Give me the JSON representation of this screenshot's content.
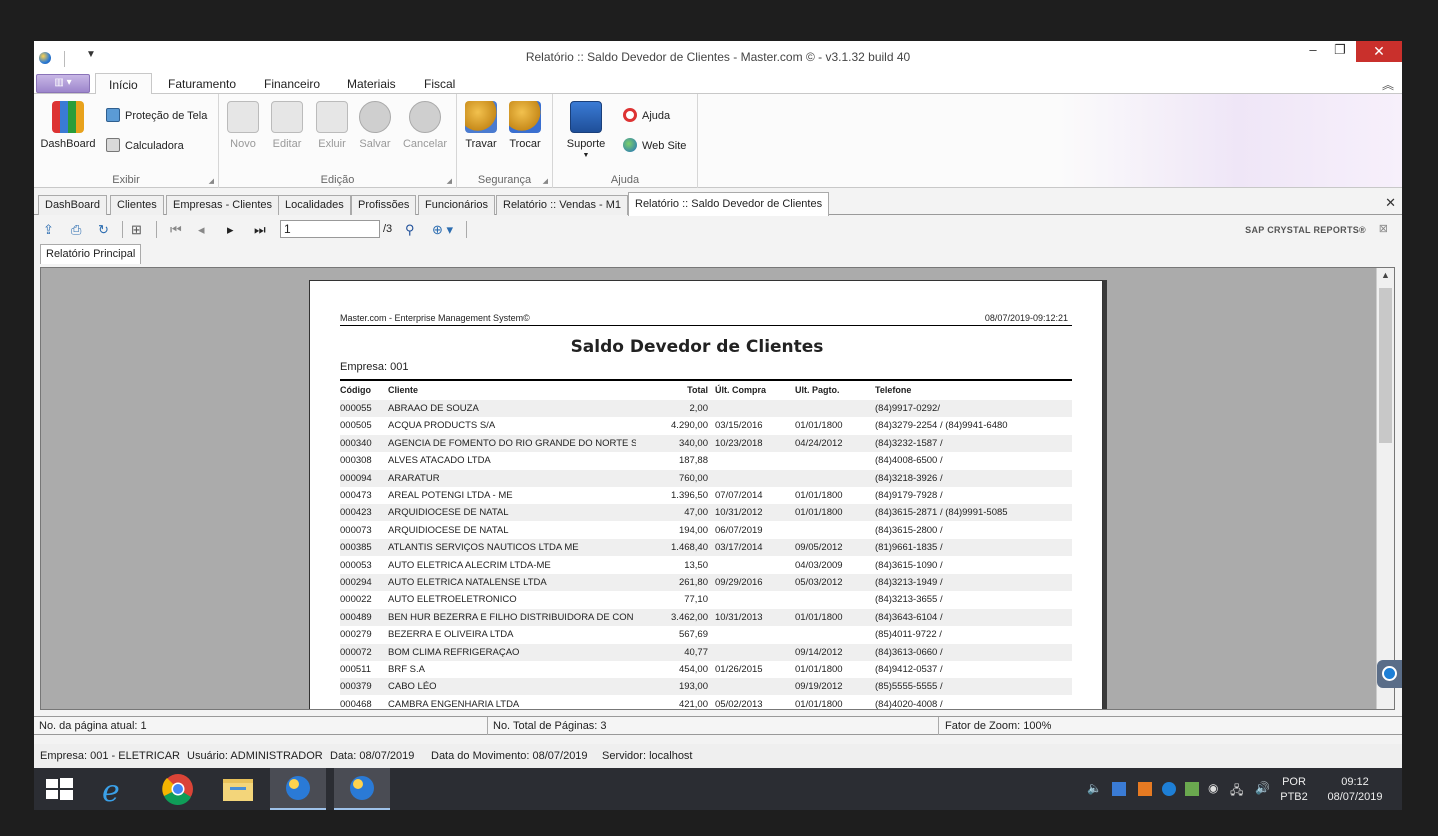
{
  "window": {
    "title": "Relatório :: Saldo Devedor de Clientes - Master.com © - v3.1.32 build 40",
    "controls": {
      "minimize": "–",
      "restore": "❐",
      "close": "✕"
    }
  },
  "ribbon": {
    "tabs": [
      "Início",
      "Faturamento",
      "Financeiro",
      "Materiais",
      "Fiscal"
    ],
    "active_tab": "Início",
    "groups": {
      "exibir": {
        "label": "Exibir",
        "dashboard": "DashBoard",
        "protecao": "Proteção de Tela",
        "calculadora": "Calculadora"
      },
      "edicao": {
        "label": "Edição",
        "novo": "Novo",
        "editar": "Editar",
        "excluir": "Exluir",
        "salvar": "Salvar",
        "cancelar": "Cancelar"
      },
      "seguranca": {
        "label": "Segurança",
        "travar": "Travar",
        "trocar": "Trocar"
      },
      "ajuda": {
        "label": "Ajuda",
        "suporte": "Suporte",
        "ajuda": "Ajuda",
        "website": "Web Site"
      }
    }
  },
  "doc_tabs": [
    "DashBoard",
    "Clientes",
    "Empresas - Clientes",
    "Localidades",
    "Profissões",
    "Funcionários",
    "Relatório :: Vendas - M1",
    "Relatório :: Saldo Devedor de Clientes"
  ],
  "report_toolbar": {
    "page_value": "1",
    "of_pages": "/3",
    "brand": "SAP CRYSTAL REPORTS®"
  },
  "report_subtab": "Relatório Principal",
  "report": {
    "system_name": "Master.com - Enterprise Management System©",
    "datetime": "08/07/2019-09:12:21",
    "title": "Saldo Devedor de Clientes",
    "empresa": "Empresa: 001",
    "columns": {
      "codigo": "Código",
      "cliente": "Cliente",
      "total": "Total",
      "ult_compra": "Últ. Compra",
      "ult_pagto": "Ult. Pagto.",
      "telefone": "Telefone"
    },
    "rows": [
      {
        "codigo": "000055",
        "cliente": "ABRAAO DE SOUZA",
        "total": "2,00",
        "compra": "",
        "pagto": "",
        "tel": "(84)9917-0292/"
      },
      {
        "codigo": "000505",
        "cliente": "ACQUA PRODUCTS S/A",
        "total": "4.290,00",
        "compra": "03/15/2016",
        "pagto": "01/01/1800",
        "tel": "(84)3279-2254 / (84)9941-6480"
      },
      {
        "codigo": "000340",
        "cliente": "AGENCIA DE FOMENTO DO RIO GRANDE DO NORTE S",
        "total": "340,00",
        "compra": "10/23/2018",
        "pagto": "04/24/2012",
        "tel": "(84)3232-1587 /"
      },
      {
        "codigo": "000308",
        "cliente": "ALVES ATACADO LTDA",
        "total": "187,88",
        "compra": "",
        "pagto": "",
        "tel": "(84)4008-6500 /"
      },
      {
        "codigo": "000094",
        "cliente": "ARARATUR",
        "total": "760,00",
        "compra": "",
        "pagto": "",
        "tel": "(84)3218-3926 /"
      },
      {
        "codigo": "000473",
        "cliente": "AREAL POTENGI LTDA - ME",
        "total": "1.396,50",
        "compra": "07/07/2014",
        "pagto": "01/01/1800",
        "tel": "(84)9179-7928 /"
      },
      {
        "codigo": "000423",
        "cliente": "ARQUIDIOCESE DE NATAL",
        "total": "47,00",
        "compra": "10/31/2012",
        "pagto": "01/01/1800",
        "tel": "(84)3615-2871 / (84)9991-5085"
      },
      {
        "codigo": "000073",
        "cliente": "ARQUIDIOCESE DE NATAL",
        "total": "194,00",
        "compra": "06/07/2019",
        "pagto": "",
        "tel": "(84)3615-2800 /"
      },
      {
        "codigo": "000385",
        "cliente": "ATLANTIS SERVIÇOS NAUTICOS LTDA ME",
        "total": "1.468,40",
        "compra": "03/17/2014",
        "pagto": "09/05/2012",
        "tel": "(81)9661-1835 /"
      },
      {
        "codigo": "000053",
        "cliente": "AUTO ELETRICA ALECRIM LTDA-ME",
        "total": "13,50",
        "compra": "",
        "pagto": "04/03/2009",
        "tel": "(84)3615-1090 /"
      },
      {
        "codigo": "000294",
        "cliente": "AUTO ELETRICA NATALENSE LTDA",
        "total": "261,80",
        "compra": "09/29/2016",
        "pagto": "05/03/2012",
        "tel": "(84)3213-1949 /"
      },
      {
        "codigo": "000022",
        "cliente": "AUTO ELETROELETRONICO",
        "total": "77,10",
        "compra": "",
        "pagto": "",
        "tel": "(84)3213-3655 /"
      },
      {
        "codigo": "000489",
        "cliente": "BEN HUR BEZERRA E FILHO DISTRIBUIDORA DE CON",
        "total": "3.462,00",
        "compra": "10/31/2013",
        "pagto": "01/01/1800",
        "tel": "(84)3643-6104 /"
      },
      {
        "codigo": "000279",
        "cliente": "BEZERRA E OLIVEIRA LTDA",
        "total": "567,69",
        "compra": "",
        "pagto": "",
        "tel": "(85)4011-9722 /"
      },
      {
        "codigo": "000072",
        "cliente": "BOM CLIMA REFRIGERAÇAO",
        "total": "40,77",
        "compra": "",
        "pagto": "09/14/2012",
        "tel": "(84)3613-0660 /"
      },
      {
        "codigo": "000511",
        "cliente": "BRF S.A",
        "total": "454,00",
        "compra": "01/26/2015",
        "pagto": "01/01/1800",
        "tel": "(84)9412-0537 /"
      },
      {
        "codigo": "000379",
        "cliente": "CABO LÉO",
        "total": "193,00",
        "compra": "",
        "pagto": "09/19/2012",
        "tel": "(85)5555-5555 /"
      },
      {
        "codigo": "000468",
        "cliente": "CAMBRA ENGENHARIA LTDA",
        "total": "421,00",
        "compra": "05/02/2013",
        "pagto": "01/01/1800",
        "tel": "(84)4020-4008 /"
      }
    ]
  },
  "viewer_status": {
    "pagina_atual": "No. da página atual: 1",
    "total_paginas": "No. Total de Páginas: 3",
    "zoom": "Fator de Zoom: 100%"
  },
  "app_status": {
    "empresa": "Empresa: 001 - ELETRICAR",
    "usuario": "Usuário: ADMINISTRADOR",
    "data": "Data: 08/07/2019",
    "movimento": "Data do Movimento: 08/07/2019",
    "servidor": "Servidor: localhost"
  },
  "taskbar": {
    "language": "POR",
    "layout": "PTB2",
    "time": "09:12",
    "date": "08/07/2019"
  },
  "colors": {
    "accent": "#2b6cb0",
    "close_red": "#c9302c",
    "taskbar": "#2b2d33"
  }
}
